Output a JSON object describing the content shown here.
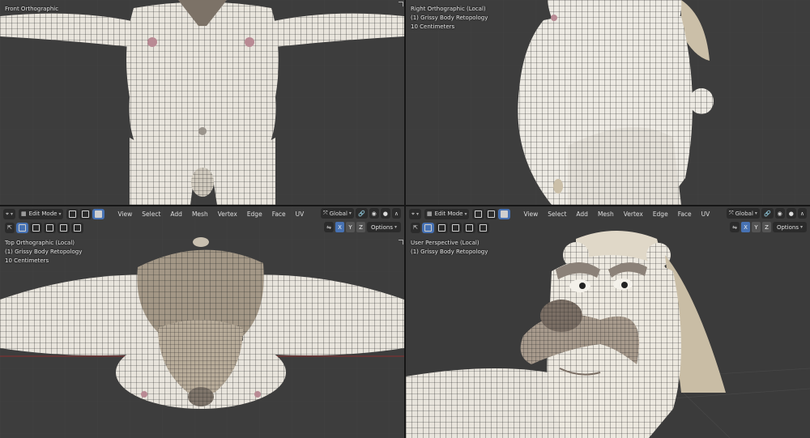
{
  "header": {
    "mode": "Edit Mode",
    "menus": [
      "View",
      "Select",
      "Add",
      "Mesh",
      "Vertex",
      "Edge",
      "Face",
      "UV"
    ],
    "transform_orientation": "Global",
    "axes": [
      "X",
      "Y",
      "Z"
    ],
    "options_label": "Options"
  },
  "viewports": {
    "front": {
      "view_name": "Front Orthographic",
      "object": "",
      "scale": ""
    },
    "right": {
      "view_name": "Right Orthographic (Local)",
      "object": "(1) Grissy Body Retopology",
      "scale": "10 Centimeters"
    },
    "top": {
      "view_name": "Top Orthographic (Local)",
      "object": "(1) Grissy Body Retopology",
      "scale": "10 Centimeters"
    },
    "perspective": {
      "view_name": "User Perspective (Local)",
      "object": "(1) Grissy Body Retopology",
      "scale": ""
    }
  },
  "colors": {
    "viewport_bg": "#3d3d3d",
    "header_active": "#4772b3",
    "mesh_body": "#e6e2d9",
    "mesh_head": "#9b8e80",
    "wire": "#1e1e1e"
  }
}
